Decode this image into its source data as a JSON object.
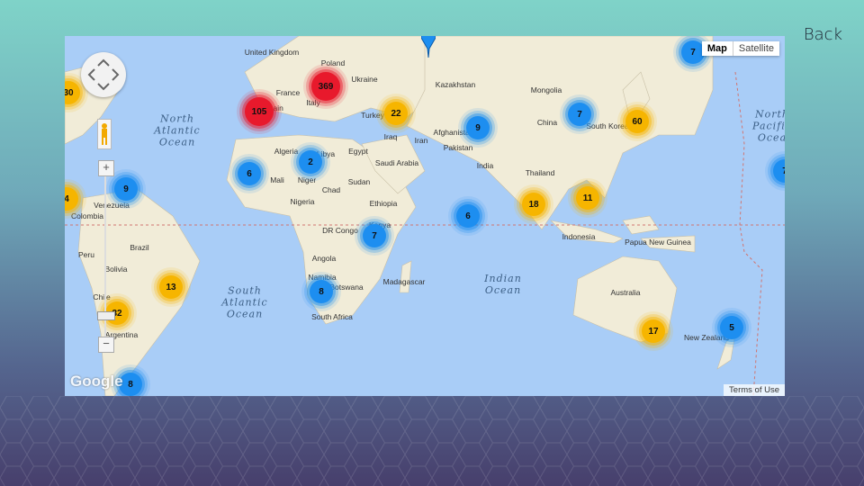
{
  "header": {
    "back_label": "Back"
  },
  "map_type": {
    "map_label": "Map",
    "satellite_label": "Satellite",
    "active": "Map"
  },
  "attribution": {
    "logo": "Google",
    "terms": "Terms of Use"
  },
  "oceans": [
    {
      "name": "North Atlantic Ocean",
      "lines": [
        "North",
        "Atlantic",
        "Ocean"
      ]
    },
    {
      "name": "South Atlantic Ocean",
      "lines": [
        "South",
        "Atlantic",
        "Ocean"
      ]
    },
    {
      "name": "Indian Ocean",
      "lines": [
        "Indian",
        "Ocean"
      ]
    },
    {
      "name": "North Pacific Ocean",
      "lines": [
        "North",
        "Pacific",
        "Ocea"
      ]
    }
  ],
  "place_labels": [
    "United Kingdom",
    "Poland",
    "Ukraine",
    "France",
    "Italy",
    "Spain",
    "Kazakhstan",
    "Mongolia",
    "Turkey",
    "Iraq",
    "Iran",
    "Afghanistan",
    "Pakistan",
    "China",
    "South Korea",
    "Algeria",
    "Libya",
    "Egypt",
    "Saudi Arabia",
    "India",
    "Mali",
    "Niger",
    "Chad",
    "Sudan",
    "Thailand",
    "Nigeria",
    "Ethiopia",
    "Venezuela",
    "Colombia",
    "Kenya",
    "DR Congo",
    "Indonesia",
    "Papua New Guinea",
    "Peru",
    "Brazil",
    "Bolivia",
    "Angola",
    "Namibia",
    "Botswana",
    "Madagascar",
    "Australia",
    "Chile",
    "South Africa",
    "Argentina",
    "New Zealand"
  ],
  "clusters": [
    {
      "count": "7",
      "color": "blue"
    },
    {
      "count": "30",
      "color": "yellow"
    },
    {
      "count": "105",
      "color": "red"
    },
    {
      "count": "369",
      "color": "red"
    },
    {
      "count": "22",
      "color": "yellow"
    },
    {
      "count": "9",
      "color": "blue"
    },
    {
      "count": "7",
      "color": "blue"
    },
    {
      "count": "60",
      "color": "yellow"
    },
    {
      "count": "7",
      "color": "blue"
    },
    {
      "count": "6",
      "color": "blue"
    },
    {
      "count": "2",
      "color": "blue"
    },
    {
      "count": "9",
      "color": "blue"
    },
    {
      "count": "4",
      "color": "yellow"
    },
    {
      "count": "6",
      "color": "blue"
    },
    {
      "count": "18",
      "color": "yellow"
    },
    {
      "count": "11",
      "color": "yellow"
    },
    {
      "count": "7",
      "color": "blue"
    },
    {
      "count": "13",
      "color": "yellow"
    },
    {
      "count": "8",
      "color": "blue"
    },
    {
      "count": "32",
      "color": "yellow"
    },
    {
      "count": "17",
      "color": "yellow"
    },
    {
      "count": "5",
      "color": "blue"
    },
    {
      "count": "8",
      "color": "blue"
    }
  ],
  "colors": {
    "cluster_blue": "#1d8ef0",
    "cluster_yellow": "#f6b500",
    "cluster_red": "#e8192c",
    "water": "#a9cdf7",
    "land": "#f1ecd8"
  }
}
